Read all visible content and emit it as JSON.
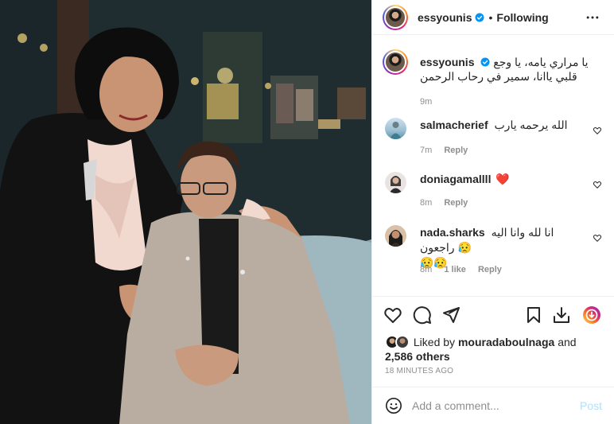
{
  "colors": {
    "accent": "#0095f6",
    "verified": "#0095f6",
    "heart_red": "#ed4956",
    "muted": "#8e8e8e",
    "border": "#efefef"
  },
  "header": {
    "username": "essyounis",
    "separator": "•",
    "follow_status": "Following",
    "more_icon": "more-horizontal-icon"
  },
  "caption": {
    "username": "essyounis",
    "text": "يا مراري يامه، يا وجع قلبي ياانا، سمير في رحاب الرحمن",
    "time": "9m"
  },
  "comments": [
    {
      "username": "salmacherief",
      "text": "الله يرحمه يارب",
      "time": "7m",
      "reply_label": "Reply"
    },
    {
      "username": "doniagamallll",
      "text": "❤️",
      "time": "8m",
      "reply_label": "Reply"
    },
    {
      "username": "nada.sharks",
      "text": "انا لله وانا اليه راجعون 😥",
      "text_line2": "😥😥",
      "time": "8m",
      "likes": "1 like",
      "reply_label": "Reply"
    }
  ],
  "actions": {
    "icons": [
      "heart-icon",
      "comment-icon",
      "share-icon",
      "bookmark-icon",
      "download-icon",
      "extension-icon"
    ]
  },
  "likes": {
    "prefix": "Liked by",
    "user": "mouradaboulnaga",
    "and": "and",
    "others": "2,586 others"
  },
  "posted_ago": "18 MINUTES AGO",
  "add_comment": {
    "placeholder": "Add a comment...",
    "post_label": "Post"
  }
}
